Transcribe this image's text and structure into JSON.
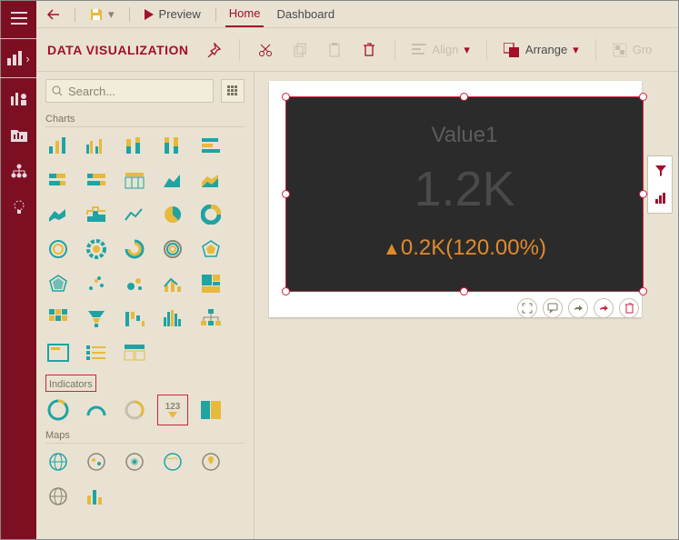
{
  "topbar": {
    "preview": "Preview",
    "tabs": {
      "home": "Home",
      "dashboard": "Dashboard"
    }
  },
  "ribbon": {
    "title": "DATA VISUALIZATION",
    "align": "Align",
    "arrange": "Arrange",
    "group": "Gro"
  },
  "panel": {
    "search_placeholder": "Search...",
    "sections": {
      "charts": "Charts",
      "indicators": "Indicators",
      "maps": "Maps"
    }
  },
  "widget": {
    "label": "Value1",
    "value": "1.2K",
    "delta": "0.2K(120.00%)"
  },
  "indicator_number_badge": "123"
}
